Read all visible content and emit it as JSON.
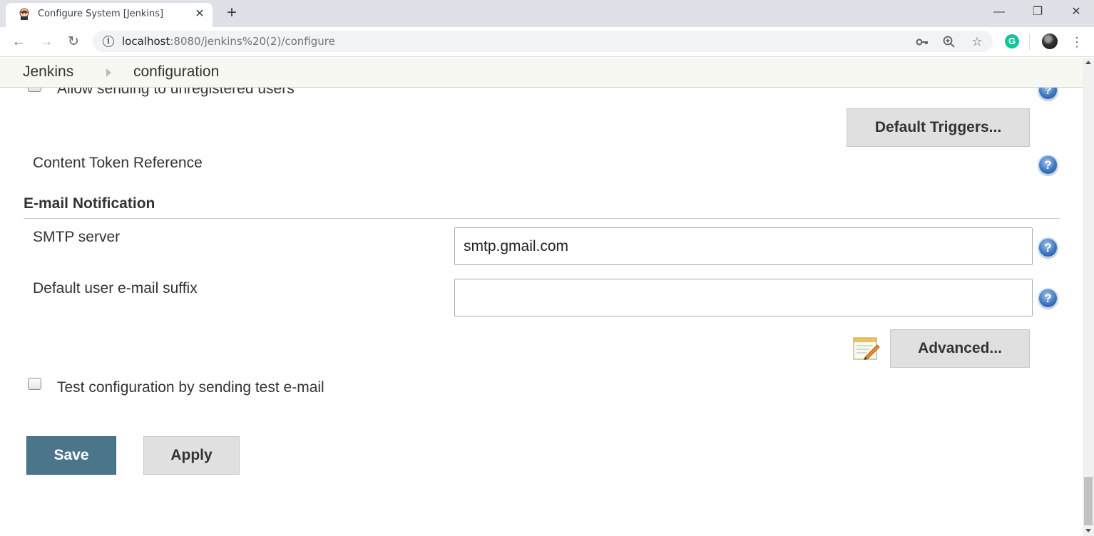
{
  "browser": {
    "tab_title": "Configure System [Jenkins]",
    "tab_close": "✕",
    "new_tab": "+",
    "url_host": "localhost",
    "url_rest": ":8080/jenkins%20(2)/configure",
    "extension_label": "G",
    "window_controls": {
      "minimize": "—",
      "restore": "❐",
      "close": "✕"
    }
  },
  "breadcrumb": {
    "items": [
      "Jenkins",
      "configuration"
    ]
  },
  "form": {
    "allow_unregistered_label": "Allow sending to unregistered users",
    "default_triggers_button": "Default Triggers...",
    "content_token_label": "Content Token Reference",
    "section_title": "E-mail Notification",
    "smtp_label": "SMTP server",
    "smtp_value": "smtp.gmail.com",
    "suffix_label": "Default user e-mail suffix",
    "suffix_value": "",
    "advanced_button": "Advanced...",
    "test_config_label": "Test configuration by sending test e-mail",
    "help_glyph": "?"
  },
  "actions": {
    "save": "Save",
    "apply": "Apply"
  },
  "colors": {
    "save_button": "#4b758b",
    "breadcrumb_bg": "#f6f8f1",
    "tab_strip_bg": "#dee1e6"
  },
  "icons": [
    "jenkins-favicon-icon",
    "back-arrow-icon",
    "forward-arrow-icon",
    "reload-icon",
    "info-icon",
    "key-icon",
    "zoom-icon",
    "star-icon",
    "grammarly-icon",
    "profile-avatar",
    "more-vert-icon",
    "help-icon",
    "notepad-icon"
  ]
}
